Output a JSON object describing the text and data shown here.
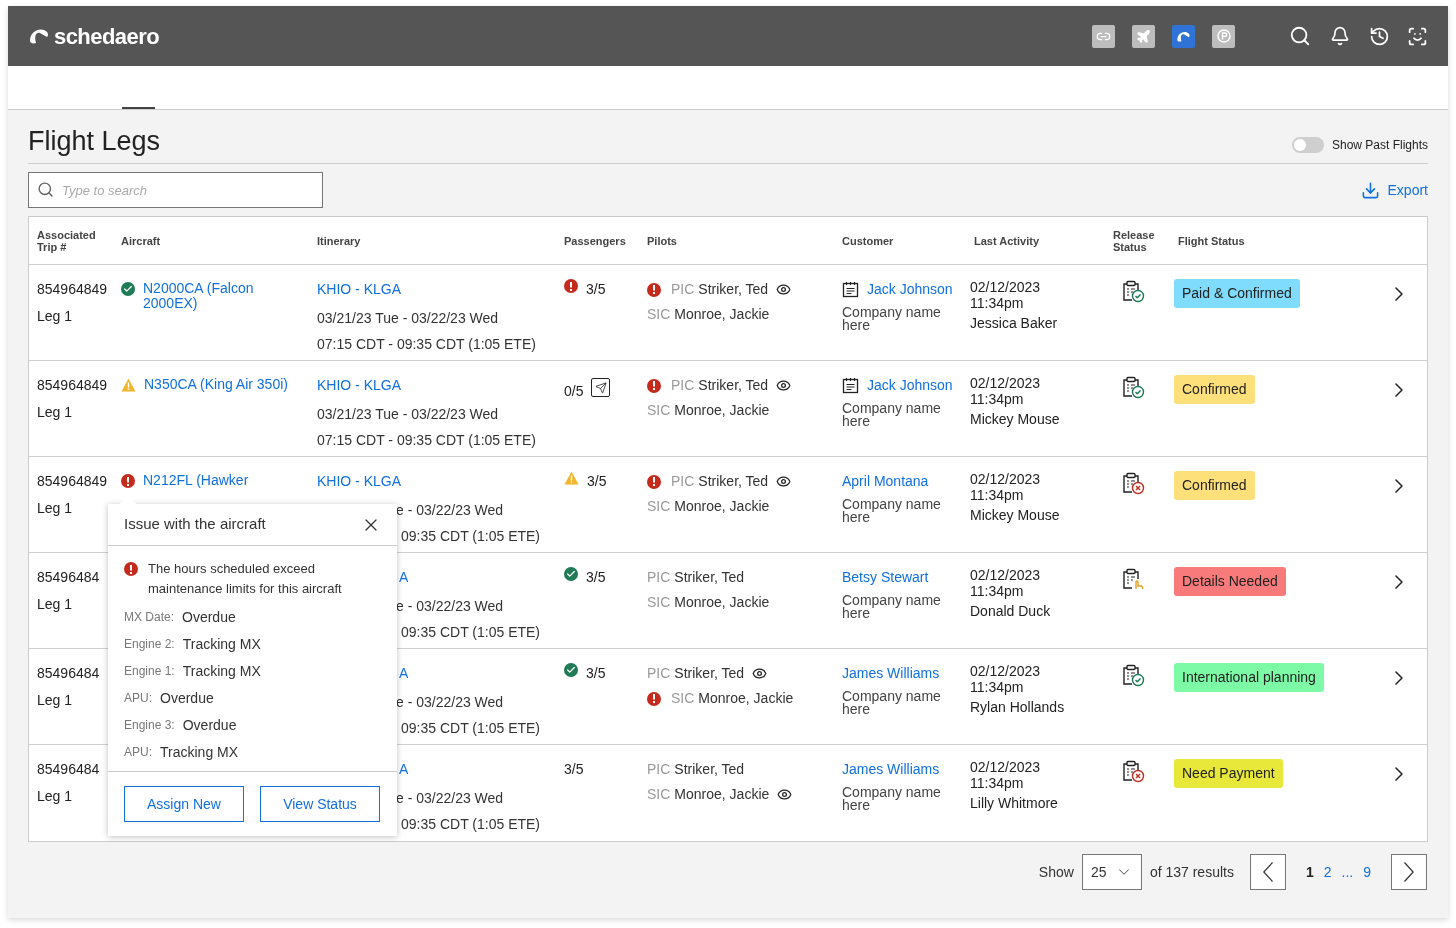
{
  "brand": "schedaero",
  "page_title": "Flight Legs",
  "past_flights_toggle": {
    "label": "Show Past Flights",
    "on": false
  },
  "search": {
    "placeholder": "Type to search"
  },
  "export_label": "Export",
  "columns": [
    "Associated Trip #",
    "Aircraft",
    "Itinerary",
    "Passengers",
    "Pilots",
    "Customer",
    "Last Activity",
    "Release Status",
    "Flight Status"
  ],
  "rows": [
    {
      "trip": "854964849",
      "leg": "Leg 1",
      "aircraft": {
        "kind": "ok",
        "name": "N2000CA (Falcon 2000EX)"
      },
      "itinerary": {
        "kind": "full",
        "route": "KHIO - KLGA",
        "dates": "03/21/23 Tue - 03/22/23 Wed",
        "times": "07:15 CDT - 09:35 CDT (1:05 ETE)"
      },
      "passengers": {
        "kind": "error",
        "count": "3/5",
        "manifest_icon": false
      },
      "pilots": [
        {
          "alert": true,
          "role": "PIC",
          "name": "Striker, Ted",
          "eye": true
        },
        {
          "alert": false,
          "role": "SIC",
          "name": "Monroe, Jackie",
          "eye": false
        }
      ],
      "customer": {
        "calendar": true,
        "name": "Jack Johnson",
        "company": "Company name here"
      },
      "activity": {
        "date": "02/12/2023",
        "time": "11:34pm",
        "user": "Jessica Baker"
      },
      "release": {
        "kind": "ok"
      },
      "flight_status": {
        "label": "Paid & Confirmed",
        "color": "#7fdcfc"
      }
    },
    {
      "trip": "854964849",
      "leg": "Leg 1",
      "aircraft": {
        "kind": "warning",
        "name": "N350CA (King Air 350i)"
      },
      "itinerary": {
        "kind": "full",
        "route": "KHIO - KLGA",
        "dates": "03/21/23 Tue - 03/22/23 Wed",
        "times": "07:15 CDT - 09:35 CDT (1:05 ETE)"
      },
      "passengers": {
        "kind": "none",
        "count": "0/5",
        "manifest_icon": true
      },
      "pilots": [
        {
          "alert": true,
          "role": "PIC",
          "name": "Striker, Ted",
          "eye": true
        },
        {
          "alert": false,
          "role": "SIC",
          "name": "Monroe, Jackie",
          "eye": false
        }
      ],
      "customer": {
        "calendar": true,
        "name": "Jack Johnson",
        "company": "Company name here"
      },
      "activity": {
        "date": "02/12/2023",
        "time": "11:34pm",
        "user": "Mickey Mouse"
      },
      "release": {
        "kind": "ok"
      },
      "flight_status": {
        "label": "Confirmed",
        "color": "#fde07a"
      }
    },
    {
      "trip": "854964849",
      "leg": "Leg 1",
      "aircraft": {
        "kind": "error",
        "name": "N212FL (Hawker"
      },
      "itinerary": {
        "kind": "partly_covered",
        "route": "KHIO - KLGA",
        "dates": "e - 03/22/23 Wed",
        "times": "09:35 CDT (1:05 ETE)"
      },
      "passengers": {
        "kind": "warning",
        "count": "3/5",
        "manifest_icon": false
      },
      "pilots": [
        {
          "alert": true,
          "role": "PIC",
          "name": "Striker, Ted",
          "eye": true
        },
        {
          "alert": false,
          "role": "SIC",
          "name": "Monroe, Jackie",
          "eye": false
        }
      ],
      "customer": {
        "calendar": false,
        "name": "April Montana",
        "company": "Company name here"
      },
      "activity": {
        "date": "02/12/2023",
        "time": "11:34pm",
        "user": "Mickey Mouse"
      },
      "release": {
        "kind": "error"
      },
      "flight_status": {
        "label": "Confirmed",
        "color": "#fde07a"
      }
    },
    {
      "trip": "85496484",
      "leg": "Leg 1",
      "itinerary": {
        "kind": "covered",
        "route": "A",
        "dates": "e - 03/22/23 Wed",
        "times": "09:35 CDT (1:05 ETE)"
      },
      "passengers": {
        "kind": "ok",
        "count": "3/5",
        "manifest_icon": false
      },
      "pilots": [
        {
          "alert": false,
          "role": "PIC",
          "name": "Striker, Ted",
          "eye": false
        },
        {
          "alert": false,
          "role": "SIC",
          "name": "Monroe, Jackie",
          "eye": false
        }
      ],
      "customer": {
        "calendar": false,
        "name": "Betsy Stewart",
        "company": "Company name here"
      },
      "activity": {
        "date": "02/12/2023",
        "time": "11:34pm",
        "user": "Donald Duck"
      },
      "release": {
        "kind": "pending"
      },
      "flight_status": {
        "label": "Details Needed",
        "color": "#f87a7a"
      }
    },
    {
      "trip": "85496484",
      "leg": "Leg 1",
      "itinerary": {
        "kind": "covered",
        "route": "A",
        "dates": "e - 03/22/23 Wed",
        "times": "09:35 CDT (1:05 ETE)"
      },
      "passengers": {
        "kind": "ok",
        "count": "3/5",
        "manifest_icon": false
      },
      "pilots": [
        {
          "alert": false,
          "role": "PIC",
          "name": "Striker, Ted",
          "eye": true
        },
        {
          "alert": true,
          "role": "SIC",
          "name": "Monroe, Jackie",
          "eye": false
        }
      ],
      "customer": {
        "calendar": false,
        "name": "James Williams",
        "company": "Company name here"
      },
      "activity": {
        "date": "02/12/2023",
        "time": "11:34pm",
        "user": "Rylan Hollands"
      },
      "release": {
        "kind": "ok"
      },
      "flight_status": {
        "label": "International planning",
        "color": "#7dfaa5"
      }
    },
    {
      "trip": "85496484",
      "leg": "Leg 1",
      "itinerary": {
        "kind": "covered",
        "route": "A",
        "dates": "e - 03/22/23 Wed",
        "times": "09:35 CDT (1:05 ETE)"
      },
      "passengers": {
        "kind": "none",
        "count": "3/5",
        "manifest_icon": false
      },
      "pilots": [
        {
          "alert": false,
          "role": "PIC",
          "name": "Striker, Ted",
          "eye": false
        },
        {
          "alert": false,
          "role": "SIC",
          "name": "Monroe, Jackie",
          "eye": true
        }
      ],
      "customer": {
        "calendar": false,
        "name": "James Williams",
        "company": "Company name here"
      },
      "activity": {
        "date": "02/12/2023",
        "time": "11:34pm",
        "user": "Lilly Whitmore"
      },
      "release": {
        "kind": "error"
      },
      "flight_status": {
        "label": "Need Payment",
        "color": "#e8e83a"
      }
    }
  ],
  "popup": {
    "title": "Issue with the aircraft",
    "message": "The hours scheduled exceed maintenance limits for this aircraft",
    "fields": [
      {
        "label": "MX Date:",
        "value": "Overdue"
      },
      {
        "label": "Engine 2:",
        "value": "Tracking MX"
      },
      {
        "label": "Engine 1:",
        "value": "Tracking MX"
      },
      {
        "label": "APU:",
        "value": "Overdue"
      },
      {
        "label": "Engine 3:",
        "value": "Overdue"
      },
      {
        "label": "APU:",
        "value": "Tracking MX"
      }
    ],
    "buttons": [
      "Assign New",
      "View Status"
    ]
  },
  "pagination": {
    "show_label": "Show",
    "page_size": "25",
    "results": "of 137 results",
    "pages": [
      {
        "label": "1",
        "selected": true
      },
      {
        "label": "2",
        "selected": false
      },
      {
        "label": "...",
        "selected": false
      },
      {
        "label": "9",
        "selected": false
      }
    ]
  }
}
